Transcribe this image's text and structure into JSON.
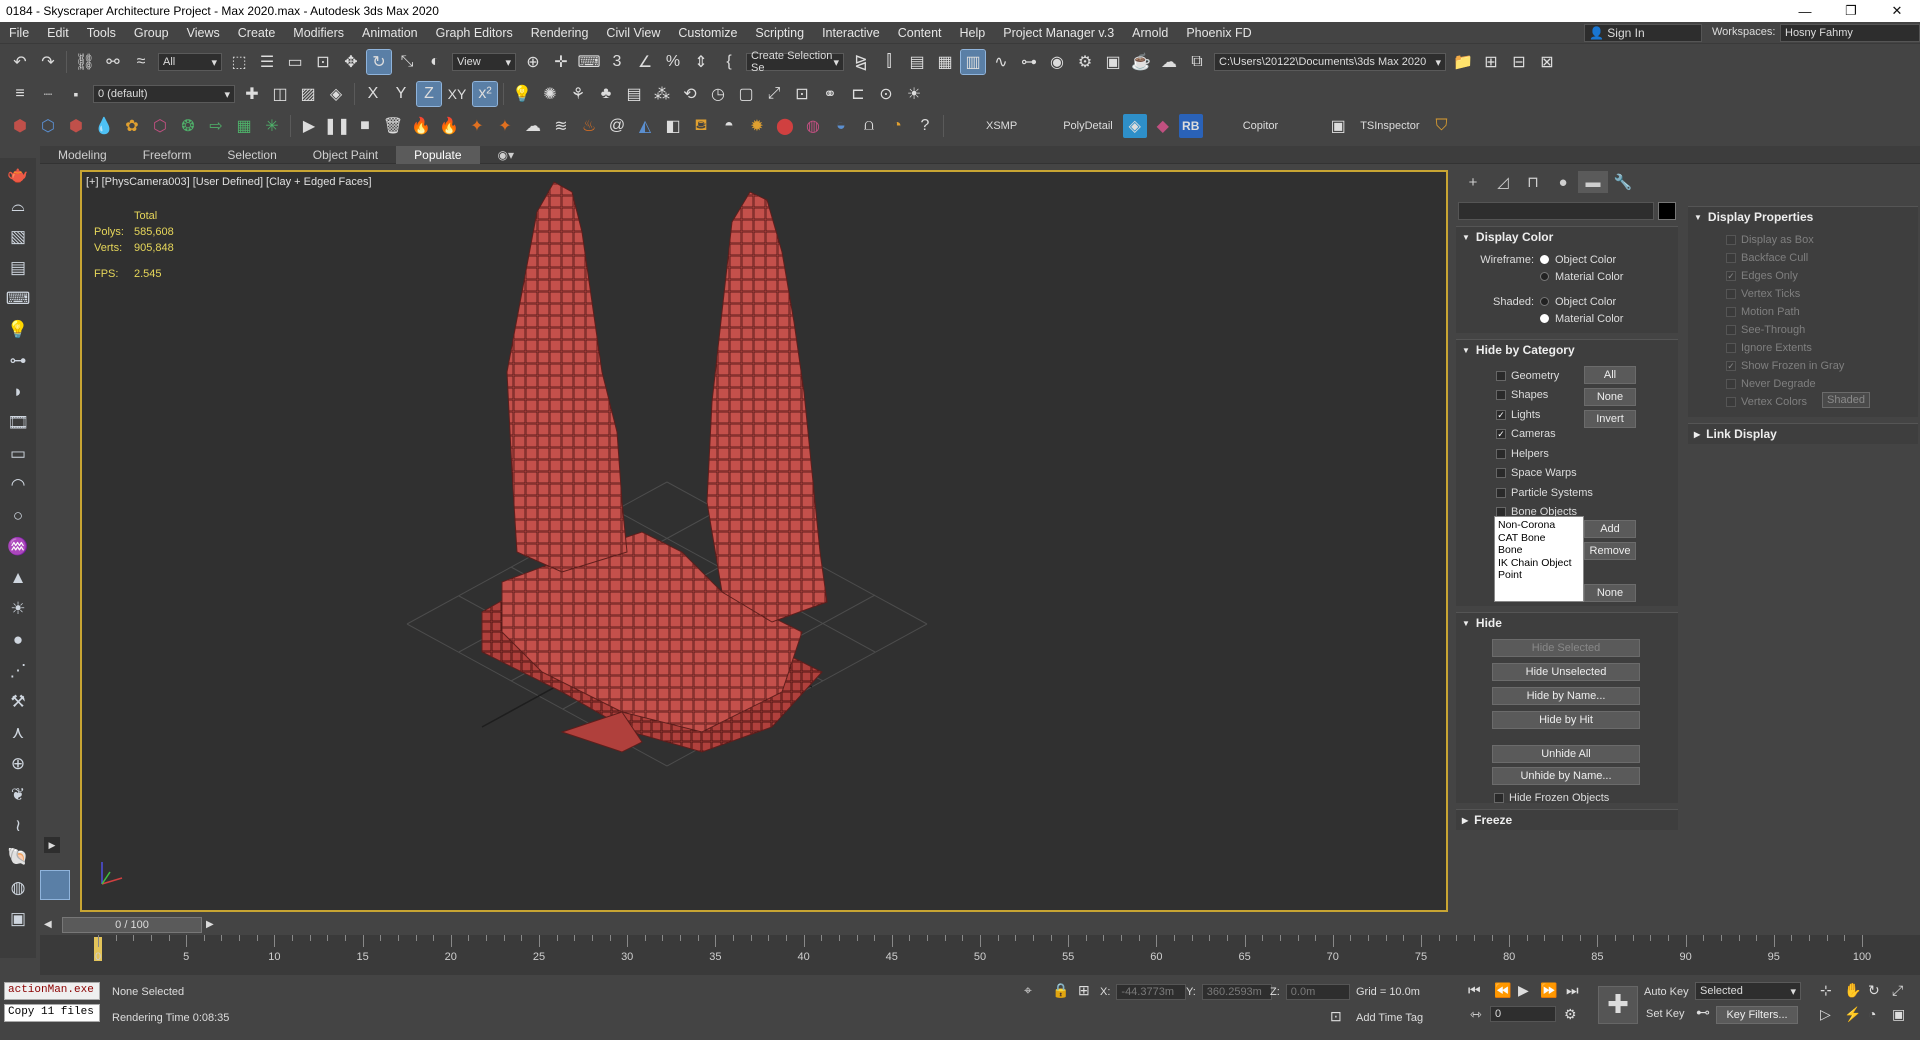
{
  "window": {
    "title": "0184 - Skyscraper Architecture Project - Max 2020.max - Autodesk 3ds Max 2020",
    "controls": [
      "—",
      "❐",
      "✕"
    ]
  },
  "menu": [
    "File",
    "Edit",
    "Tools",
    "Group",
    "Views",
    "Create",
    "Modifiers",
    "Animation",
    "Graph Editors",
    "Rendering",
    "Civil View",
    "Customize",
    "Scripting",
    "Interactive",
    "Content",
    "Help",
    "Project Manager v.3",
    "Arnold",
    "Phoenix FD"
  ],
  "account": {
    "sign_in": "Sign In",
    "workspaces_label": "Workspaces:",
    "workspace": "Hosny Fahmy"
  },
  "toolbar1": {
    "selection_filter": "All",
    "ref_coord": "View",
    "named_selection": "Create Selection Se",
    "project_path": "C:\\Users\\20122\\Documents\\3ds Max 2020"
  },
  "toolbar2": {
    "layer": "0 (default)",
    "axis_x": "X",
    "axis_y": "Y",
    "axis_z": "Z",
    "axis_xy": "XY"
  },
  "toolbar3": {
    "xsmp": "XSMP",
    "polydetail": "PolyDetail",
    "rb": "RB",
    "copitor": "Copitor",
    "tsinspector": "TSInspector"
  },
  "ribbon": {
    "tabs": [
      "Modeling",
      "Freeform",
      "Selection",
      "Object Paint",
      "Populate"
    ],
    "selected": "Populate"
  },
  "viewport": {
    "label": "[+] [PhysCamera003] [User Defined] [Clay + Edged Faces]",
    "stats_header": "Total",
    "polys_label": "Polys:",
    "polys": "585,608",
    "verts_label": "Verts:",
    "verts": "905,848",
    "fps_label": "FPS:",
    "fps": "2.545",
    "model_color": "#b0403c"
  },
  "command_panel": {
    "display_color": {
      "title": "Display Color",
      "wireframe_label": "Wireframe:",
      "shaded_label": "Shaded:",
      "object_color": "Object Color",
      "material_color": "Material Color"
    },
    "hide_by_category": {
      "title": "Hide by Category",
      "items": [
        {
          "label": "Geometry",
          "checked": false
        },
        {
          "label": "Shapes",
          "checked": false
        },
        {
          "label": "Lights",
          "checked": true
        },
        {
          "label": "Cameras",
          "checked": true
        },
        {
          "label": "Helpers",
          "checked": false
        },
        {
          "label": "Space Warps",
          "checked": false
        },
        {
          "label": "Particle Systems",
          "checked": false
        },
        {
          "label": "Bone Objects",
          "checked": false
        }
      ],
      "btn_all": "All",
      "btn_none": "None",
      "btn_invert": "Invert",
      "list": [
        "Non-Corona",
        "CAT Bone",
        "Bone",
        "IK Chain Object",
        "Point"
      ],
      "btn_add": "Add",
      "btn_remove": "Remove",
      "btn_none2": "None"
    },
    "hide": {
      "title": "Hide",
      "hide_selected": "Hide Selected",
      "hide_unselected": "Hide Unselected",
      "hide_by_name": "Hide by Name...",
      "hide_by_hit": "Hide by Hit",
      "unhide_all": "Unhide All",
      "unhide_by_name": "Unhide by Name...",
      "hide_frozen": "Hide Frozen Objects"
    },
    "freeze": {
      "title": "Freeze"
    }
  },
  "display_properties": {
    "title": "Display Properties",
    "items": [
      {
        "label": "Display as Box",
        "checked": false
      },
      {
        "label": "Backface Cull",
        "checked": false
      },
      {
        "label": "Edges Only",
        "checked": true
      },
      {
        "label": "Vertex Ticks",
        "checked": false
      },
      {
        "label": "Motion Path",
        "checked": false
      },
      {
        "label": "See-Through",
        "checked": false
      },
      {
        "label": "Ignore Extents",
        "checked": false
      },
      {
        "label": "Show Frozen in Gray",
        "checked": true
      },
      {
        "label": "Never Degrade",
        "checked": false
      },
      {
        "label": "Vertex Colors",
        "checked": false
      }
    ],
    "shaded_btn": "Shaded",
    "link_display": "Link Display"
  },
  "timeline": {
    "slider_label": "0 / 100",
    "ticks": [
      "0",
      "5",
      "10",
      "15",
      "20",
      "25",
      "30",
      "35",
      "40",
      "45",
      "50",
      "55",
      "60",
      "65",
      "70",
      "75",
      "80",
      "85",
      "90",
      "95",
      "100"
    ],
    "progress": 0
  },
  "status": {
    "maxscript_line1": "actionMan.exe",
    "maxscript_line2": "Copy 11 files",
    "selection": "None Selected",
    "render_time": "Rendering Time  0:08:35",
    "x_label": "X:",
    "x": "-44.3773m",
    "y_label": "Y:",
    "y": "360.2593m",
    "z_label": "Z:",
    "z": "0.0m",
    "grid": "Grid = 10.0m",
    "add_time_tag": "Add Time Tag",
    "auto_key": "Auto Key",
    "key_mode": "Selected",
    "set_key": "Set Key",
    "key_filters": "Key Filters...",
    "frame": "0"
  }
}
